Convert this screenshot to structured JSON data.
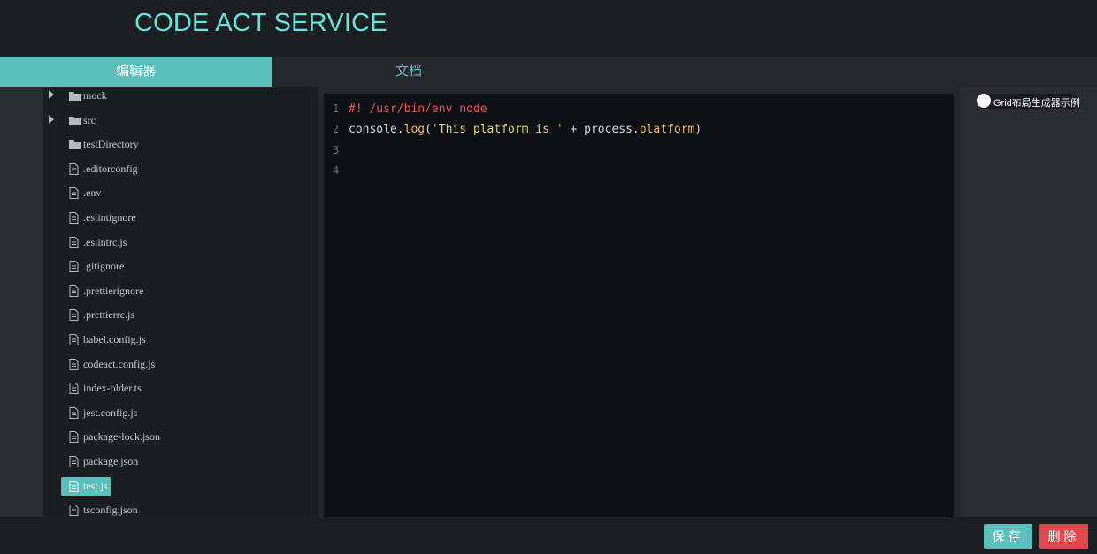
{
  "header": {
    "title": "CODE ACT SERVICE"
  },
  "tabs": [
    {
      "label": "编辑器",
      "active": true
    },
    {
      "label": "文档",
      "active": false
    }
  ],
  "tree": {
    "items": [
      {
        "label": "mock",
        "type": "folder",
        "expandable": true
      },
      {
        "label": "src",
        "type": "folder",
        "expandable": true
      },
      {
        "label": "testDirectory",
        "type": "folder",
        "expandable": false
      },
      {
        "label": ".editorconfig",
        "type": "file"
      },
      {
        "label": ".env",
        "type": "file"
      },
      {
        "label": ".eslintignore",
        "type": "file"
      },
      {
        "label": ".eslintrc.js",
        "type": "file"
      },
      {
        "label": ".gitignore",
        "type": "file"
      },
      {
        "label": ".prettierignore",
        "type": "file"
      },
      {
        "label": ".prettierrc.js",
        "type": "file"
      },
      {
        "label": "babel.config.js",
        "type": "file"
      },
      {
        "label": "codeact.config.js",
        "type": "file"
      },
      {
        "label": "index-older.ts",
        "type": "file"
      },
      {
        "label": "jest.config.js",
        "type": "file"
      },
      {
        "label": "package-lock.json",
        "type": "file"
      },
      {
        "label": "package.json",
        "type": "file"
      },
      {
        "label": "test.js",
        "type": "file",
        "selected": true
      },
      {
        "label": "tsconfig.json",
        "type": "file"
      }
    ]
  },
  "editor": {
    "lines": [
      {
        "num": "1",
        "tokens": [
          {
            "t": "#! /usr/bin/env node",
            "c": "shebang"
          }
        ]
      },
      {
        "num": "2",
        "tokens": [
          {
            "t": "console.",
            "c": "plain"
          },
          {
            "t": "log",
            "c": "fn"
          },
          {
            "t": "(",
            "c": "plain"
          },
          {
            "t": "'This platform is '",
            "c": "str"
          },
          {
            "t": " + process.",
            "c": "plain"
          },
          {
            "t": "platform",
            "c": "prop"
          },
          {
            "t": ")",
            "c": "plain"
          }
        ]
      },
      {
        "num": "3",
        "tokens": []
      },
      {
        "num": "4",
        "tokens": []
      }
    ]
  },
  "right_panel": {
    "toggle_label": "Grid布局生成器示例"
  },
  "footer": {
    "save_label": "保存",
    "delete_label": "删除"
  },
  "colors": {
    "accent": "#5bbfbd",
    "title": "#67e4dc",
    "danger": "#e0494b"
  }
}
